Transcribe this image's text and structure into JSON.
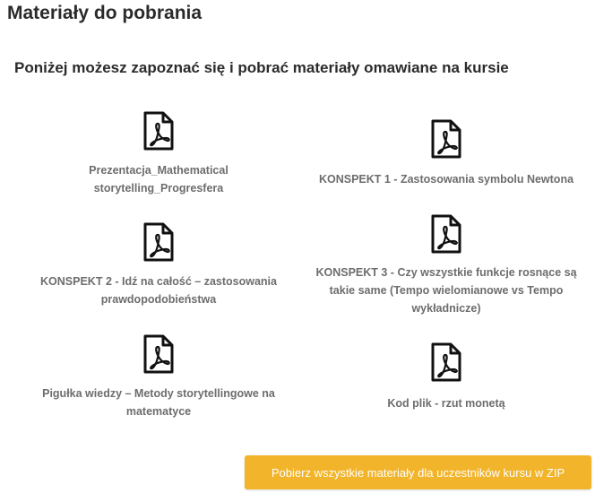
{
  "page": {
    "title": "Materiały do pobrania",
    "subtitle": "Poniżej możesz zapoznać się i pobrać materiały omawiane na kursie"
  },
  "files": [
    {
      "icon": "pdf-file-icon",
      "label_line1": "Prezentacja_Mathematical",
      "label_line2": "storytelling_Progresfera",
      "label_line3": ""
    },
    {
      "icon": "pdf-file-icon",
      "label_line1": "KONSPEKT 1 - Zastosowania symbolu Newtona",
      "label_line2": "",
      "label_line3": ""
    },
    {
      "icon": "pdf-file-icon",
      "label_line1": "KONSPEKT 2 - Idź na całość – zastosowania",
      "label_line2": "prawdopodobieństwa",
      "label_line3": ""
    },
    {
      "icon": "pdf-file-icon",
      "label_line1": "KONSPEKT 3 - Czy wszystkie funkcje rosnące są",
      "label_line2": "takie same (Tempo wielomianowe vs Tempo",
      "label_line3": "wykładnicze)"
    },
    {
      "icon": "pdf-file-icon",
      "label_line1": "Pigułka wiedzy – Metody storytellingowe na",
      "label_line2": "matematyce",
      "label_line3": ""
    },
    {
      "icon": "pdf-file-icon",
      "label_line1": "Kod plik - rzut monetą",
      "label_line2": "",
      "label_line3": ""
    }
  ],
  "download_all": {
    "label": "Pobierz wszystkie materiały dla uczestników kursu w ZIP",
    "color": "#f1b42a"
  }
}
